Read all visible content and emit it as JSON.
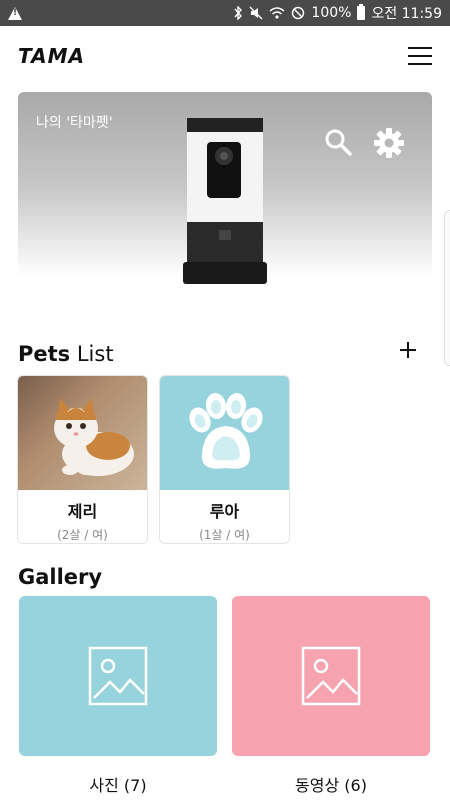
{
  "status_bar": {
    "battery": "100%",
    "time": "오전 11:59"
  },
  "header": {
    "logo": "TAMA",
    "menu_icon": "hamburger-menu-icon"
  },
  "device": {
    "name": "나의 '타마펫'",
    "search_icon": "search-icon",
    "settings_icon": "gear-icon"
  },
  "pets": {
    "title_bold": "Pets",
    "title_light": "List",
    "add_icon": "plus-icon",
    "items": [
      {
        "name": "제리",
        "info": "(2살 / 여)"
      },
      {
        "name": "루아",
        "info": "(1살 / 여)"
      }
    ]
  },
  "gallery": {
    "title": "Gallery",
    "photos_label": "사진 (7)",
    "videos_label": "동영상 (6)",
    "photos_color": "#97d3dc",
    "videos_color": "#f7a3af"
  },
  "colors": {
    "accent_teal": "#97d3dc",
    "accent_pink": "#f7a3af",
    "status_bar": "#4a4a4a"
  }
}
